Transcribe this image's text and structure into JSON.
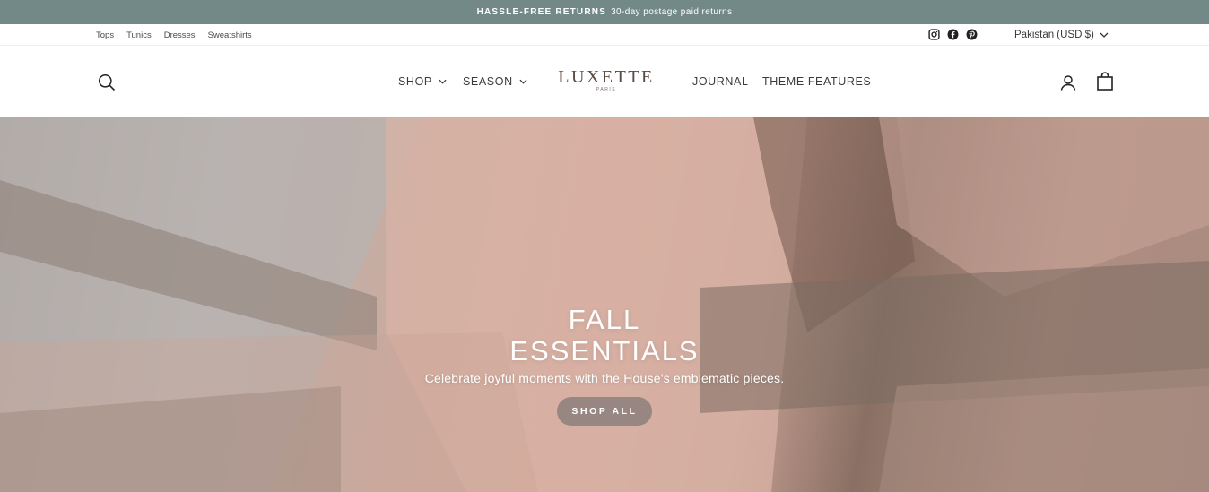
{
  "announcement": {
    "highlight": "HASSLE-FREE RETURNS",
    "text": "30-day postage paid returns"
  },
  "utility": {
    "links": [
      "Tops",
      "Tunics",
      "Dresses",
      "Sweatshirts"
    ],
    "social": [
      "instagram-icon",
      "facebook-icon",
      "pinterest-icon"
    ],
    "currency": "Pakistan (USD $)"
  },
  "header": {
    "nav_left": [
      {
        "label": "SHOP"
      },
      {
        "label": "SEASON"
      }
    ],
    "logo": {
      "name": "LUXETTE",
      "sub": "PARIS"
    },
    "nav_right": [
      {
        "label": "JOURNAL"
      },
      {
        "label": "THEME FEATURES"
      }
    ],
    "icons": [
      "search-icon",
      "account-icon",
      "cart-icon"
    ]
  },
  "hero": {
    "title_line1": "FALL",
    "title_line2": "ESSENTIALS",
    "subtitle": "Celebrate joyful moments with the House's emblematic pieces.",
    "button": "SHOP ALL"
  },
  "colors": {
    "announcement_bg": "#738987",
    "text": "#3a3a3a",
    "logo": "#5a4a44"
  }
}
